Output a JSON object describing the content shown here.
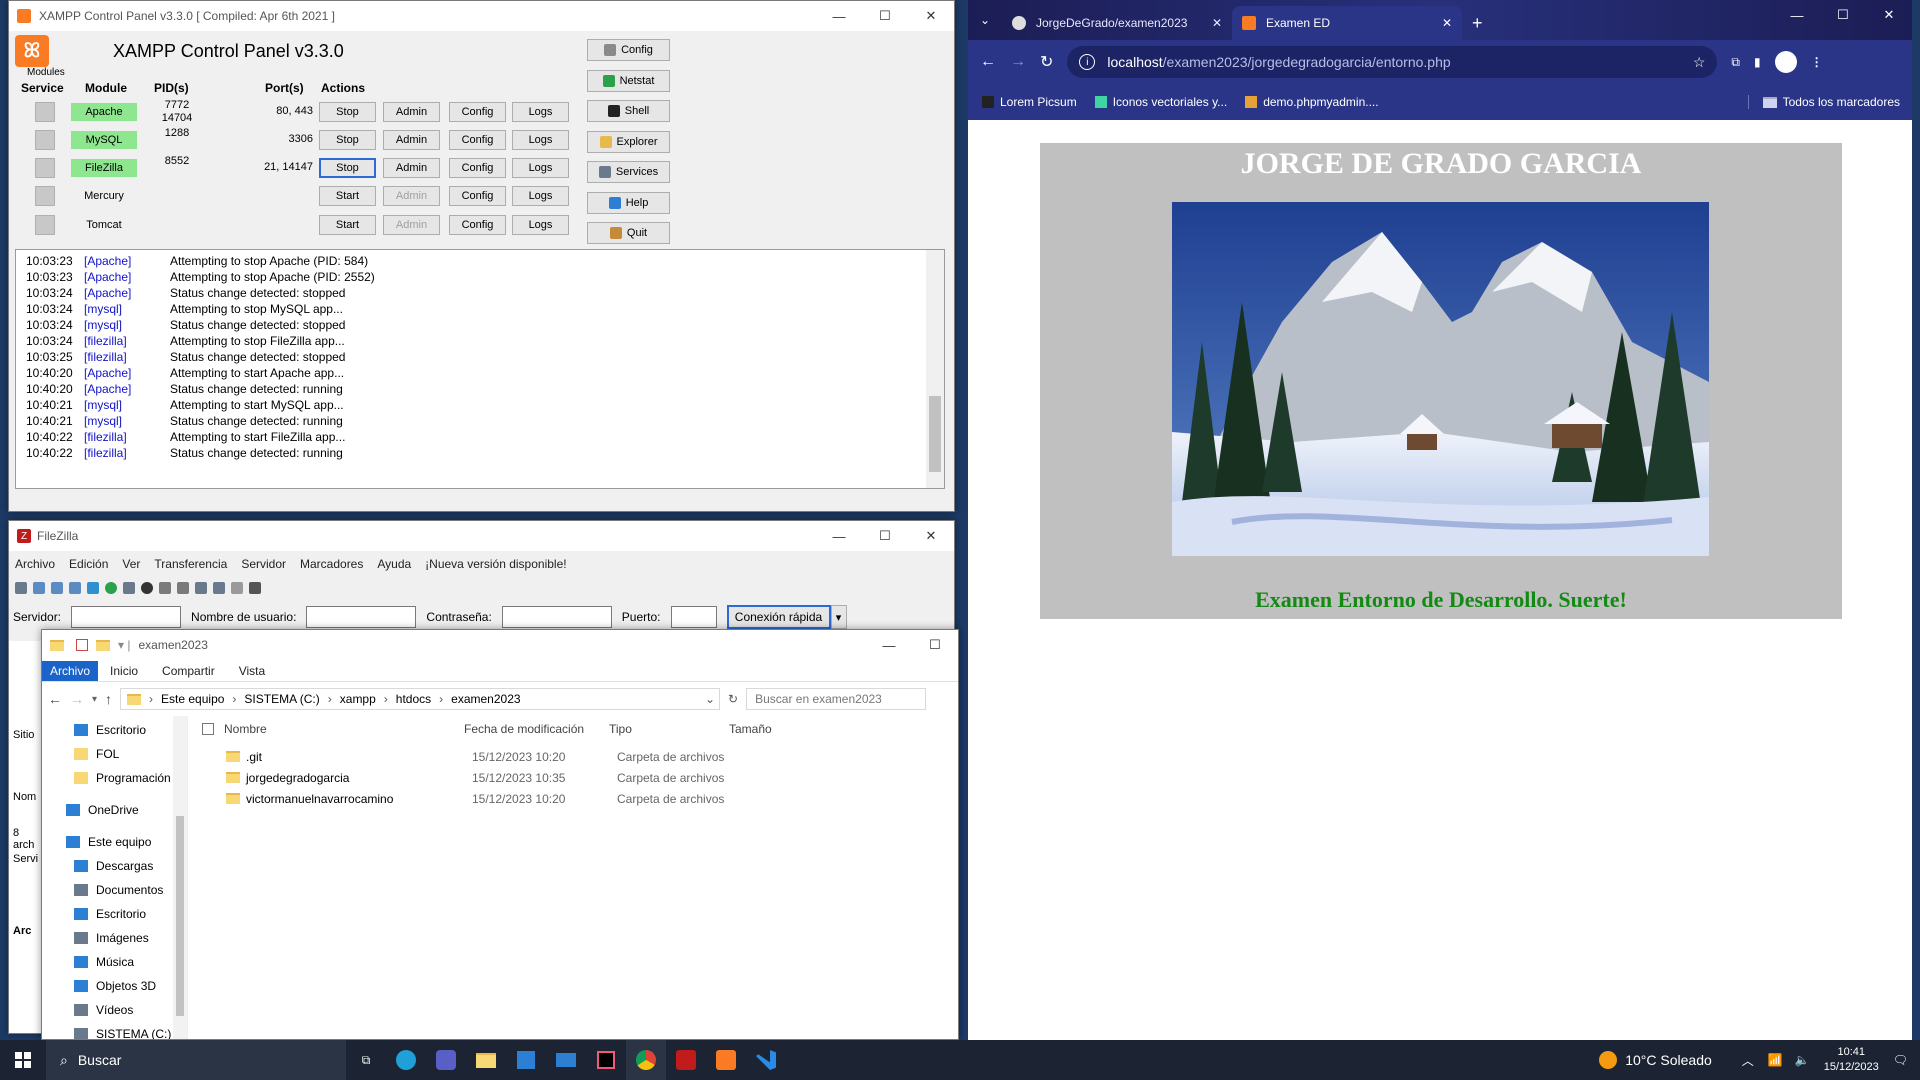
{
  "xampp": {
    "title": "XAMPP Control Panel v3.3.0   [ Compiled: Apr 6th 2021 ]",
    "header": "XAMPP Control Panel v3.3.0",
    "modules_label": "Modules",
    "cols": {
      "service": "Service",
      "module": "Module",
      "pids": "PID(s)",
      "ports": "Port(s)",
      "actions": "Actions"
    },
    "rows": [
      {
        "module": "Apache",
        "pid": "7772\n14704",
        "ports": "80, 443",
        "action": "Stop",
        "running": true
      },
      {
        "module": "MySQL",
        "pid": "1288",
        "ports": "3306",
        "action": "Stop",
        "running": true
      },
      {
        "module": "FileZilla",
        "pid": "8552",
        "ports": "21, 14147",
        "action": "Stop",
        "running": true
      },
      {
        "module": "Mercury",
        "pid": "",
        "ports": "",
        "action": "Start",
        "running": false
      },
      {
        "module": "Tomcat",
        "pid": "",
        "ports": "",
        "action": "Start",
        "running": false
      }
    ],
    "admin_label": "Admin",
    "config_label": "Config",
    "logs_label": "Logs",
    "tools": [
      "Config",
      "Netstat",
      "Shell",
      "Explorer",
      "Services",
      "Help",
      "Quit"
    ],
    "log": [
      {
        "time": "10:03:23",
        "mod": "[Apache]",
        "msg": "Attempting to stop Apache (PID: 584)"
      },
      {
        "time": "10:03:23",
        "mod": "[Apache]",
        "msg": "Attempting to stop Apache (PID: 2552)"
      },
      {
        "time": "10:03:24",
        "mod": "[Apache]",
        "msg": "Status change detected: stopped"
      },
      {
        "time": "10:03:24",
        "mod": "[mysql]",
        "msg": "Attempting to stop MySQL app..."
      },
      {
        "time": "10:03:24",
        "mod": "[mysql]",
        "msg": "Status change detected: stopped"
      },
      {
        "time": "10:03:24",
        "mod": "[filezilla]",
        "msg": "Attempting to stop FileZilla app..."
      },
      {
        "time": "10:03:25",
        "mod": "[filezilla]",
        "msg": "Status change detected: stopped"
      },
      {
        "time": "10:40:20",
        "mod": "[Apache]",
        "msg": "Attempting to start Apache app..."
      },
      {
        "time": "10:40:20",
        "mod": "[Apache]",
        "msg": "Status change detected: running"
      },
      {
        "time": "10:40:21",
        "mod": "[mysql]",
        "msg": "Attempting to start MySQL app..."
      },
      {
        "time": "10:40:21",
        "mod": "[mysql]",
        "msg": "Status change detected: running"
      },
      {
        "time": "10:40:22",
        "mod": "[filezilla]",
        "msg": "Attempting to start FileZilla app..."
      },
      {
        "time": "10:40:22",
        "mod": "[filezilla]",
        "msg": "Status change detected: running"
      }
    ]
  },
  "filezilla": {
    "title": "FileZilla",
    "menu": [
      "Archivo",
      "Edición",
      "Ver",
      "Transferencia",
      "Servidor",
      "Marcadores",
      "Ayuda",
      "¡Nueva versión disponible!"
    ],
    "server_label": "Servidor:",
    "user_label": "Nombre de usuario:",
    "pass_label": "Contraseña:",
    "port_label": "Puerto:",
    "quick_connect": "Conexión rápida",
    "side_labels": [
      "Sitio",
      "Nom",
      "8 arch",
      "Servi",
      "Arc"
    ]
  },
  "explorer": {
    "title": "examen2023",
    "ribbon": [
      "Archivo",
      "Inicio",
      "Compartir",
      "Vista"
    ],
    "path": [
      "Este equipo",
      "SISTEMA (C:)",
      "xampp",
      "htdocs",
      "examen2023"
    ],
    "search_placeholder": "Buscar en examen2023",
    "cols": {
      "name": "Nombre",
      "date": "Fecha de modificación",
      "type": "Tipo",
      "size": "Tamaño"
    },
    "files": [
      {
        "name": ".git",
        "date": "15/12/2023 10:20",
        "type": "Carpeta de archivos"
      },
      {
        "name": "jorgedegradogarcia",
        "date": "15/12/2023 10:35",
        "type": "Carpeta de archivos"
      },
      {
        "name": "victormanuelnavarrocamino",
        "date": "15/12/2023 10:20",
        "type": "Carpeta de archivos"
      }
    ],
    "nav": [
      "Escritorio",
      "FOL",
      "Programación",
      "OneDrive",
      "Este equipo",
      "Descargas",
      "Documentos",
      "Escritorio",
      "Imágenes",
      "Música",
      "Objetos 3D",
      "Vídeos",
      "SISTEMA (C:)"
    ]
  },
  "browser": {
    "tabs": [
      {
        "label": "JorgeDeGrado/examen2023"
      },
      {
        "label": "Examen ED"
      }
    ],
    "url_host": "localhost",
    "url_path": "/examen2023/jorgedegradogarcia/entorno.php",
    "bookmarks": [
      "Lorem Picsum",
      "Iconos vectoriales y...",
      "demo.phpmyadmin...."
    ],
    "all_bookmarks": "Todos los marcadores",
    "page_title": "JORGE DE GRADO GARCIA",
    "page_footer": "Examen Entorno de Desarrollo. Suerte!"
  },
  "taskbar": {
    "search": "Buscar",
    "weather": "10°C  Soleado",
    "time": "10:41",
    "date": "15/12/2023"
  },
  "colors": {
    "accent": "#fb7a24",
    "running": "#8ee68e",
    "log_module": "#1212c8",
    "page_footer": "#138a13"
  }
}
